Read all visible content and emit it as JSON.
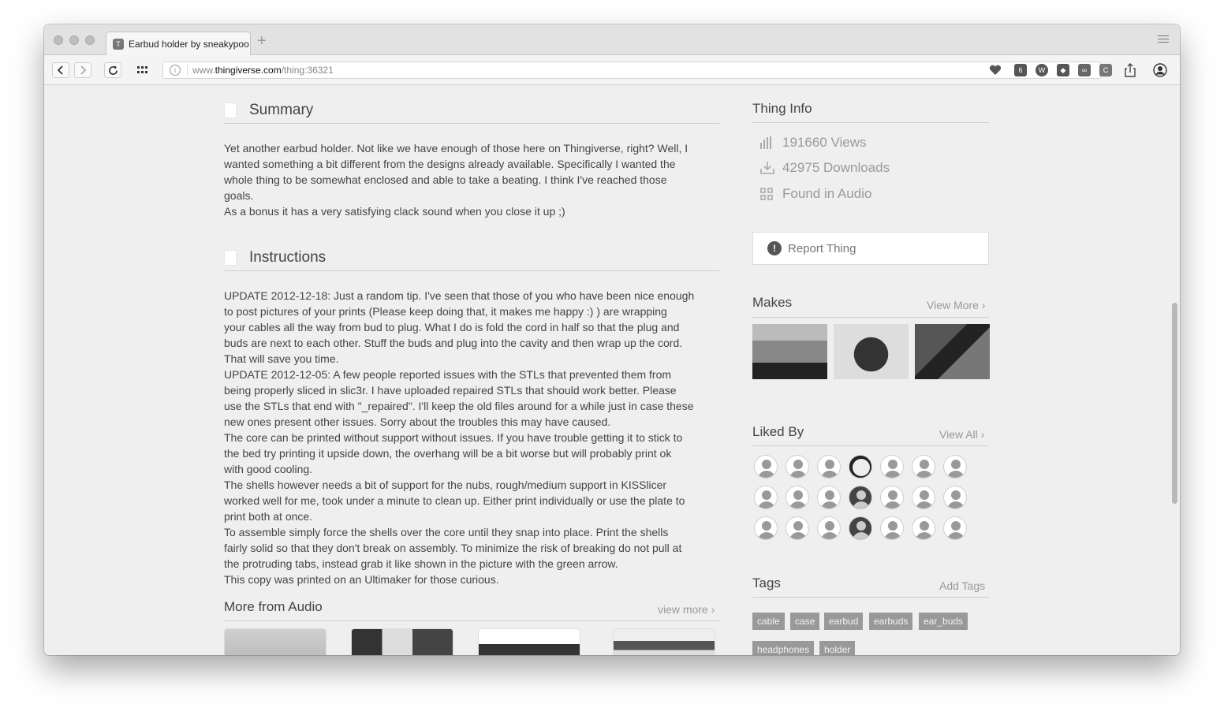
{
  "browser": {
    "tab_title": "Earbud holder by sneakypoo",
    "tab_favicon": "T",
    "new_tab": "+",
    "url_subdomain": "www.",
    "url_host": "thingiverse.com",
    "url_path": "/thing:36321"
  },
  "summary": {
    "title": "Summary",
    "lines": [
      "Yet another earbud holder. Not like we have enough of those here on Thingiverse, right? Well, I",
      "wanted something a bit different from the designs already available. Specifically I wanted the",
      "whole thing to be somewhat enclosed and able to take a beating. I think I've reached those",
      "goals.",
      "As a bonus it has a very satisfying clack sound when you close it up ;)"
    ]
  },
  "instructions": {
    "title": "Instructions",
    "lines": [
      "UPDATE 2012-12-18: Just a random tip. I've seen that those of you who have been nice enough",
      "to post pictures of your prints (Please keep doing that, it makes me happy :) ) are wrapping",
      "your cables all the way from bud to plug. What I do is fold the cord in half so that the plug and",
      "buds are next to each other. Stuff the buds and plug into the cavity and then wrap up the cord.",
      "That will save you time.",
      "UPDATE 2012-12-05: A few people reported issues with the STLs that prevented them from",
      "being properly sliced in slic3r. I have uploaded repaired STLs that should work better. Please",
      "use the STLs that end with \"_repaired\". I'll keep the old files around for a while just in case these",
      "new ones present other issues. Sorry about the troubles this may have caused.",
      "The core can be printed without support without issues. If you have trouble getting it to stick to",
      "the bed try printing it upside down, the overhang will be a bit worse but will probably print ok",
      "with good cooling.",
      "The shells however needs a bit of support for the nubs, rough/medium support in KISSlicer",
      "worked well for me, took under a minute to clean up. Either print individually or use the plate to",
      "print both at once.",
      "To assemble simply force the shells over the core until they snap into place. Print the shells",
      "fairly solid so that they don't break on assembly. To minimize the risk of breaking do not pull at",
      "the protruding tabs, instead grab it like shown in the picture with the green arrow.",
      "This copy was printed on an Ultimaker for those curious."
    ]
  },
  "more_from": {
    "title": "More from Audio",
    "link": "view more"
  },
  "thing_info": {
    "title": "Thing Info",
    "views": "191660 Views",
    "downloads": "42975 Downloads",
    "category": "Found in Audio",
    "report": "Report Thing"
  },
  "makes": {
    "title": "Makes",
    "link": "View More"
  },
  "liked_by": {
    "title": "Liked By",
    "link": "View All"
  },
  "tags": {
    "title": "Tags",
    "add": "Add Tags",
    "items": [
      "cable",
      "case",
      "earbud",
      "earbuds",
      "ear_buds",
      "headphones",
      "holder"
    ]
  },
  "icons": {
    "chevron": "›",
    "report": "!"
  }
}
